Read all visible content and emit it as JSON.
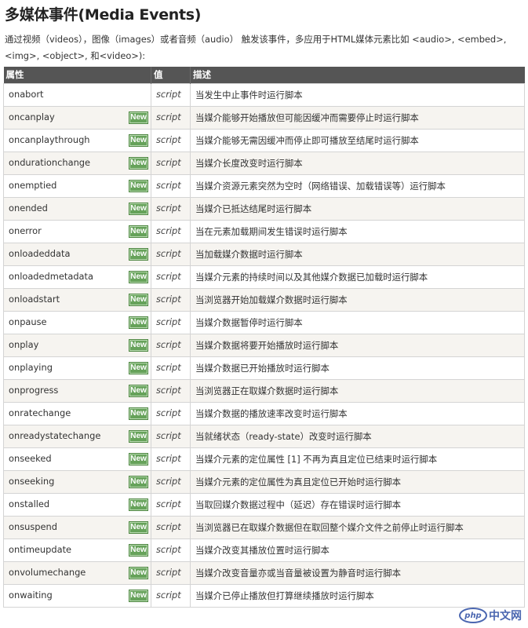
{
  "page": {
    "title": "多媒体事件(Media Events)",
    "intro": "通过视频（videos），图像（images）或者音频（audio） 触发该事件，多应用于HTML媒体元素比如 <audio>, <embed>, <img>, <object>, 和<video>):"
  },
  "table": {
    "headers": [
      "属性",
      "值",
      "描述"
    ],
    "badge_label": "New",
    "rows": [
      {
        "attr": "onabort",
        "value": "script",
        "desc": "当发生中止事件时运行脚本",
        "is_new": false
      },
      {
        "attr": "oncanplay",
        "value": "script",
        "desc": "当媒介能够开始播放但可能因缓冲而需要停止时运行脚本",
        "is_new": true
      },
      {
        "attr": "oncanplaythrough",
        "value": "script",
        "desc": "当媒介能够无需因缓冲而停止即可播放至结尾时运行脚本",
        "is_new": true
      },
      {
        "attr": "ondurationchange",
        "value": "script",
        "desc": "当媒介长度改变时运行脚本",
        "is_new": true
      },
      {
        "attr": "onemptied",
        "value": "script",
        "desc": "当媒介资源元素突然为空时（网络错误、加载错误等）运行脚本",
        "is_new": true
      },
      {
        "attr": "onended",
        "value": "script",
        "desc": "当媒介已抵达结尾时运行脚本",
        "is_new": true
      },
      {
        "attr": "onerror",
        "value": "script",
        "desc": "当在元素加载期间发生错误时运行脚本",
        "is_new": true
      },
      {
        "attr": "onloadeddata",
        "value": "script",
        "desc": "当加载媒介数据时运行脚本",
        "is_new": true
      },
      {
        "attr": "onloadedmetadata",
        "value": "script",
        "desc": "当媒介元素的持续时间以及其他媒介数据已加载时运行脚本",
        "is_new": true
      },
      {
        "attr": "onloadstart",
        "value": "script",
        "desc": "当浏览器开始加载媒介数据时运行脚本",
        "is_new": true
      },
      {
        "attr": "onpause",
        "value": "script",
        "desc": "当媒介数据暂停时运行脚本",
        "is_new": true
      },
      {
        "attr": "onplay",
        "value": "script",
        "desc": "当媒介数据将要开始播放时运行脚本",
        "is_new": true
      },
      {
        "attr": "onplaying",
        "value": "script",
        "desc": "当媒介数据已开始播放时运行脚本",
        "is_new": true
      },
      {
        "attr": "onprogress",
        "value": "script",
        "desc": "当浏览器正在取媒介数据时运行脚本",
        "is_new": true
      },
      {
        "attr": "onratechange",
        "value": "script",
        "desc": "当媒介数据的播放速率改变时运行脚本",
        "is_new": true
      },
      {
        "attr": "onreadystatechange",
        "value": "script",
        "desc": "当就绪状态（ready-state）改变时运行脚本",
        "is_new": true
      },
      {
        "attr": "onseeked",
        "value": "script",
        "desc": "当媒介元素的定位属性 [1] 不再为真且定位已结束时运行脚本",
        "is_new": true
      },
      {
        "attr": "onseeking",
        "value": "script",
        "desc": "当媒介元素的定位属性为真且定位已开始时运行脚本",
        "is_new": true
      },
      {
        "attr": "onstalled",
        "value": "script",
        "desc": "当取回媒介数据过程中（延迟）存在错误时运行脚本",
        "is_new": true
      },
      {
        "attr": "onsuspend",
        "value": "script",
        "desc": "当浏览器已在取媒介数据但在取回整个媒介文件之前停止时运行脚本",
        "is_new": true
      },
      {
        "attr": "ontimeupdate",
        "value": "script",
        "desc": "当媒介改变其播放位置时运行脚本",
        "is_new": true
      },
      {
        "attr": "onvolumechange",
        "value": "script",
        "desc": "当媒介改变音量亦或当音量被设置为静音时运行脚本",
        "is_new": true
      },
      {
        "attr": "onwaiting",
        "value": "script",
        "desc": "当媒介已停止播放但打算继续播放时运行脚本",
        "is_new": true
      }
    ]
  },
  "watermark": {
    "logo_text": "php",
    "site_text": "中文网"
  }
}
